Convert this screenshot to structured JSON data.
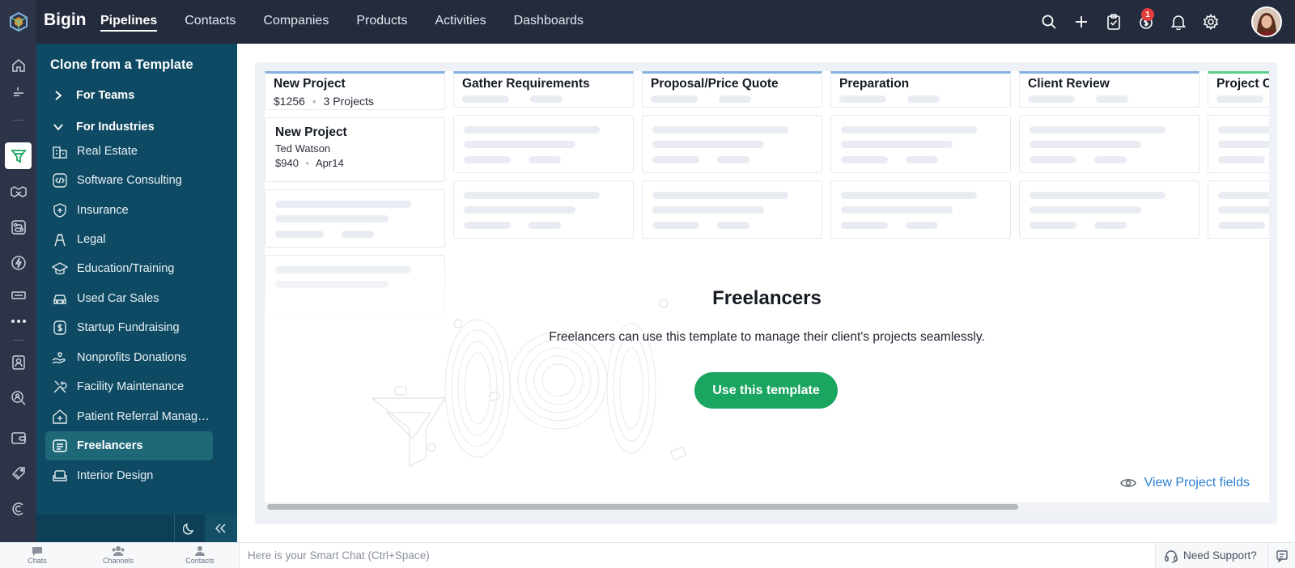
{
  "app": {
    "brand": "Bigin"
  },
  "nav": {
    "items": [
      {
        "label": "Pipelines",
        "active": true
      },
      {
        "label": "Contacts"
      },
      {
        "label": "Companies"
      },
      {
        "label": "Products"
      },
      {
        "label": "Activities"
      },
      {
        "label": "Dashboards"
      }
    ]
  },
  "header": {
    "icons": [
      "search-icon",
      "plus-icon",
      "tasks-icon",
      "deals-icon",
      "bell-icon",
      "gear-icon"
    ],
    "notification_count": "1"
  },
  "panel": {
    "title": "Clone from a Template",
    "sections": {
      "teams": "For Teams",
      "industries": "For Industries"
    },
    "industries": [
      {
        "label": "Real Estate",
        "icon": "building-icon"
      },
      {
        "label": "Software Consulting",
        "icon": "code-icon"
      },
      {
        "label": "Insurance",
        "icon": "shield-plus-icon"
      },
      {
        "label": "Legal",
        "icon": "scale-icon"
      },
      {
        "label": "Education/Training",
        "icon": "graduation-cap-icon"
      },
      {
        "label": "Used Car Sales",
        "icon": "car-icon"
      },
      {
        "label": "Startup Fundraising",
        "icon": "dollar-icon"
      },
      {
        "label": "Nonprofits Donations",
        "icon": "hand-heart-icon"
      },
      {
        "label": "Facility Maintenance",
        "icon": "tools-icon"
      },
      {
        "label": "Patient Referral Management",
        "icon": "house-plus-icon"
      },
      {
        "label": "Freelancers",
        "icon": "laptop-icon",
        "selected": true
      },
      {
        "label": "Interior Design",
        "icon": "sofa-icon"
      }
    ]
  },
  "preview": {
    "stages": [
      {
        "name": "New Project",
        "amount": "$1256",
        "count": "3 Projects"
      },
      {
        "name": "Gather Requirements"
      },
      {
        "name": "Proposal/Price Quote"
      },
      {
        "name": "Preparation"
      },
      {
        "name": "Client Review"
      },
      {
        "name": "Project Completed"
      }
    ],
    "deal": {
      "name": "New Project",
      "contact": "Ted Watson",
      "amount": "$940",
      "date": "Apr14"
    }
  },
  "hero": {
    "title": "Freelancers",
    "description": "Freelancers can use this template to manage their client's projects seamlessly.",
    "cta": "Use this template",
    "view_fields": "View Project fields"
  },
  "bottom": {
    "tabs": [
      "Chats",
      "Channels",
      "Contacts"
    ],
    "smartchat_placeholder": "Here is your Smart Chat (Ctrl+Space)",
    "support": "Need Support?"
  },
  "colors": {
    "topbar": "#242b3d",
    "panel": "#0e4a63",
    "selected": "#1e6878",
    "cta": "#1aa561",
    "link": "#2b7fd1"
  }
}
